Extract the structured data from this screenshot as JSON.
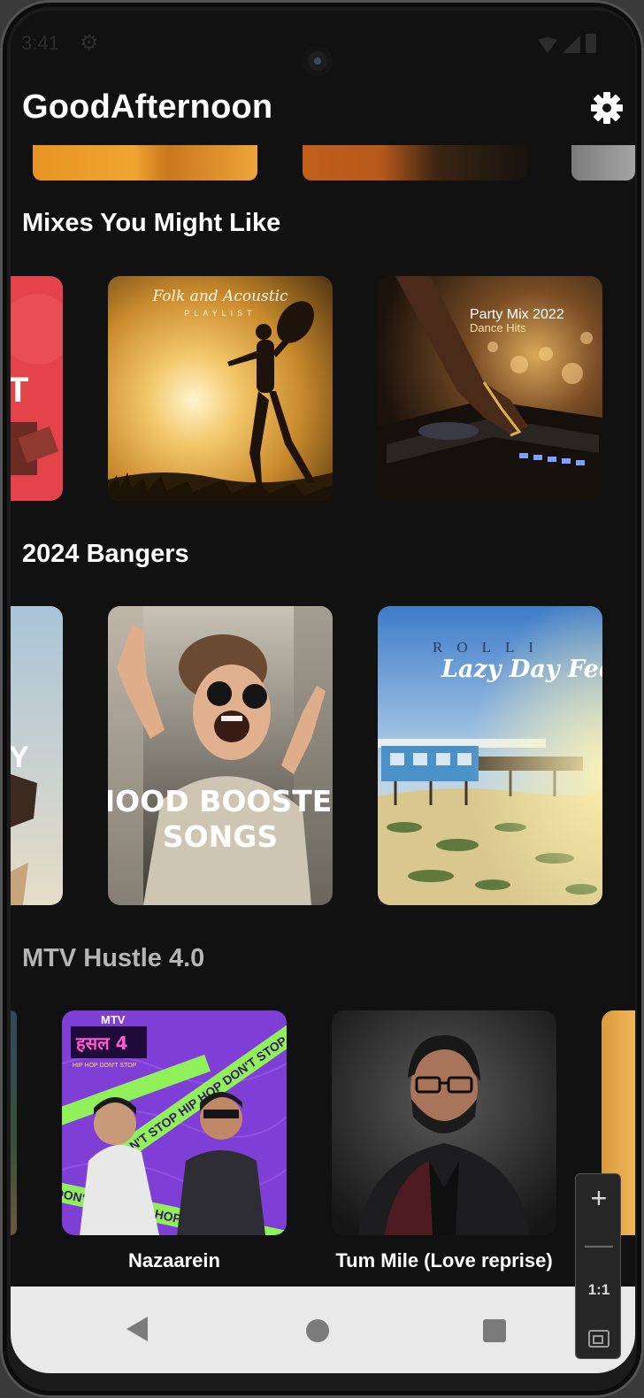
{
  "status_bar": {
    "time": "3:41"
  },
  "header": {
    "title": "GoodAfternoon",
    "settings_icon": "gear-icon"
  },
  "sections": [
    {
      "title": "Mixes You Might Like",
      "cards": [
        {
          "art_text": "T"
        },
        {
          "art_title": "Folk and Acoustic",
          "art_subtitle": "PLAYLIST"
        },
        {
          "art_title": "Party Mix 2022",
          "art_subtitle": "Dance Hits"
        }
      ]
    },
    {
      "title": "2024 Bangers",
      "cards": [
        {
          "art_text": "Y"
        },
        {
          "art_line1": "MOOD BOOSTER",
          "art_line2": "SONGS"
        },
        {
          "art_top": "ROLLI",
          "art_title": "Lazy Day Fee"
        }
      ]
    },
    {
      "title": "MTV Hustle 4.0",
      "cards": [
        {
          "art_logo": "हसल 4",
          "art_logo_sub": "HIP HOP DON'T STOP",
          "art_brand": "MTV",
          "art_tape": "DON'T STOP HIP HOP DON'T STOP",
          "caption": "Nazaarein"
        },
        {
          "caption": "Tum Mile (Love reprise)"
        }
      ]
    }
  ],
  "emulator_controls": {
    "zoom_in": "+",
    "zoom_out": "—",
    "reset": "1:1"
  },
  "colors": {
    "background": "#111111",
    "nav_bar": "#e9e9e9",
    "text": "#ffffff"
  }
}
